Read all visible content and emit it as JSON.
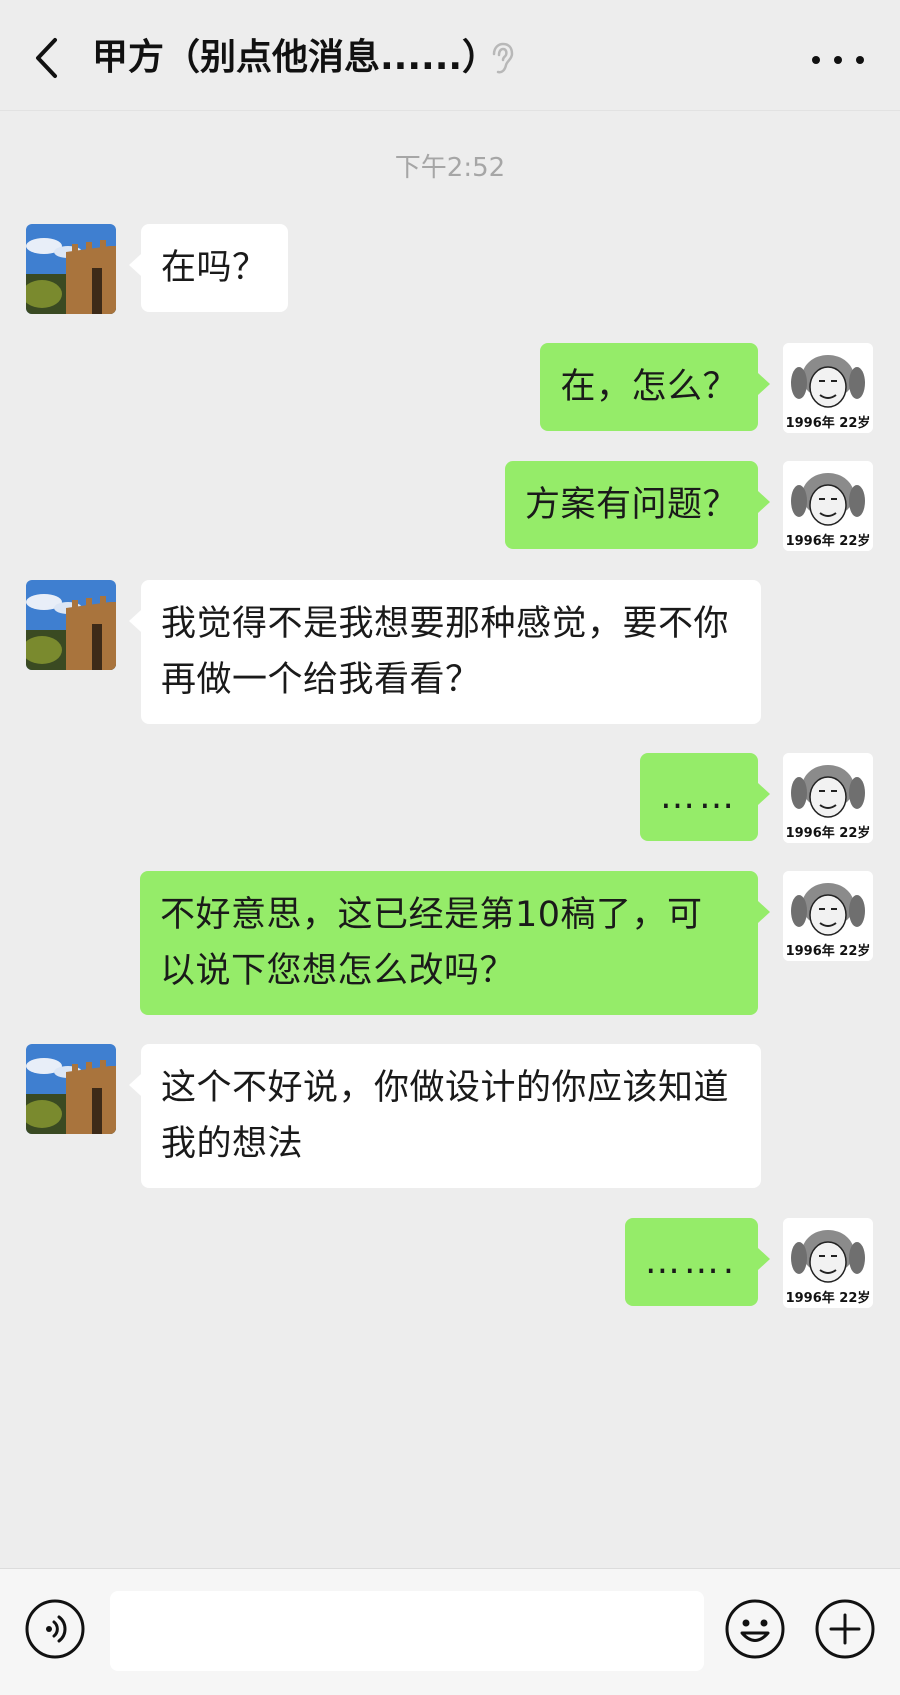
{
  "header": {
    "title": "甲方（别点他消息......）"
  },
  "timestamp": "下午2:52",
  "avatars": {
    "self_caption": "1996年 22岁"
  },
  "messages": [
    {
      "side": "left",
      "text": "在吗？"
    },
    {
      "side": "right",
      "text": "在，怎么？"
    },
    {
      "side": "right",
      "text": "方案有问题？"
    },
    {
      "side": "left",
      "text": "我觉得不是我想要那种感觉，要不你再做一个给我看看？"
    },
    {
      "side": "right",
      "text": "……"
    },
    {
      "side": "right",
      "text": "不好意思，这已经是第10稿了，可以说下您想怎么改吗？"
    },
    {
      "side": "left",
      "text": "这个不好说，你做设计的你应该知道我的想法"
    },
    {
      "side": "right",
      "text": "……."
    }
  ],
  "composer": {
    "placeholder": ""
  },
  "icons": {
    "back": "chevron-left-icon",
    "ear": "ear-icon",
    "more": "more-icon",
    "voice": "voice-icon",
    "emoji": "emoji-icon",
    "plus": "plus-icon"
  },
  "colors": {
    "background": "#ededed",
    "self_bubble": "#95ec69",
    "other_bubble": "#ffffff",
    "timestamp": "#a6a6a6"
  }
}
